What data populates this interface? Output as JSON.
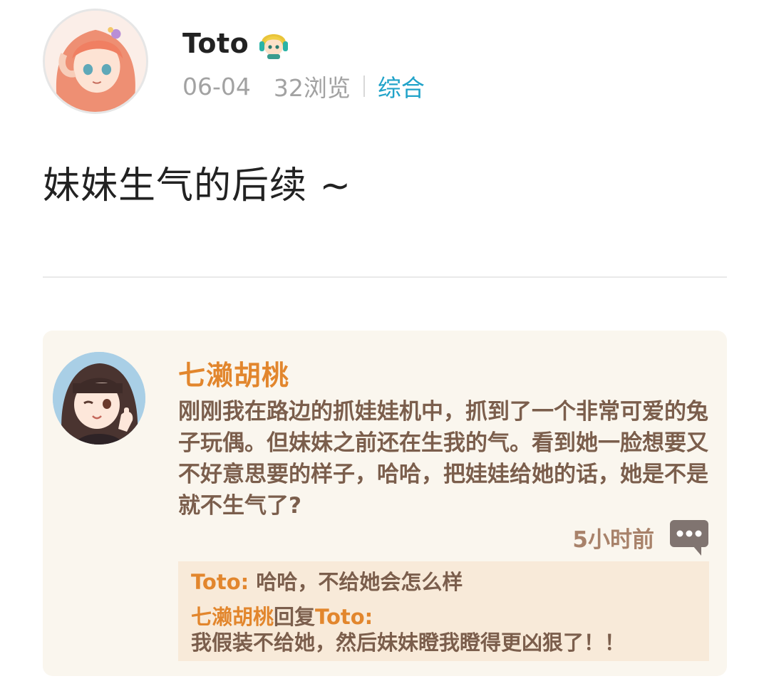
{
  "author": {
    "name": "Toto",
    "date": "06-04",
    "views": "32浏览",
    "category": "综合",
    "avatar_icon": "anime-girl-avatar",
    "badge_icon": "chibi-character-badge"
  },
  "post": {
    "title": "妹妹生气的后续 ~"
  },
  "card": {
    "avatar_icon": "anime-girl-wink-avatar",
    "username": "七濑胡桃",
    "body": "刚刚我在路边的抓娃娃机中，抓到了一个非常可爱的兔子玩偶。但妹妹之前还在生我的气。看到她一脸想要又不好意思要的样子，哈哈，把娃娃给她的话，她是不是就不生气了?",
    "time": "5小时前",
    "comment_icon": "comment-bubble-icon",
    "replies": {
      "r1_name": "Toto:",
      "r1_text": " 哈哈，不给她会怎么样",
      "r2_name": "七濑胡桃",
      "r2_mid": "回复",
      "r2_target": "Toto:",
      "r2_text": "我假装不给她，然后妹妹瞪我瞪得更凶狠了！！"
    }
  },
  "colors": {
    "category": "#21a3c9",
    "card_name": "#e2862d",
    "card_text": "#7b5e4c",
    "card_bg": "#faf6ee",
    "reply_bg": "#f8ead9"
  }
}
